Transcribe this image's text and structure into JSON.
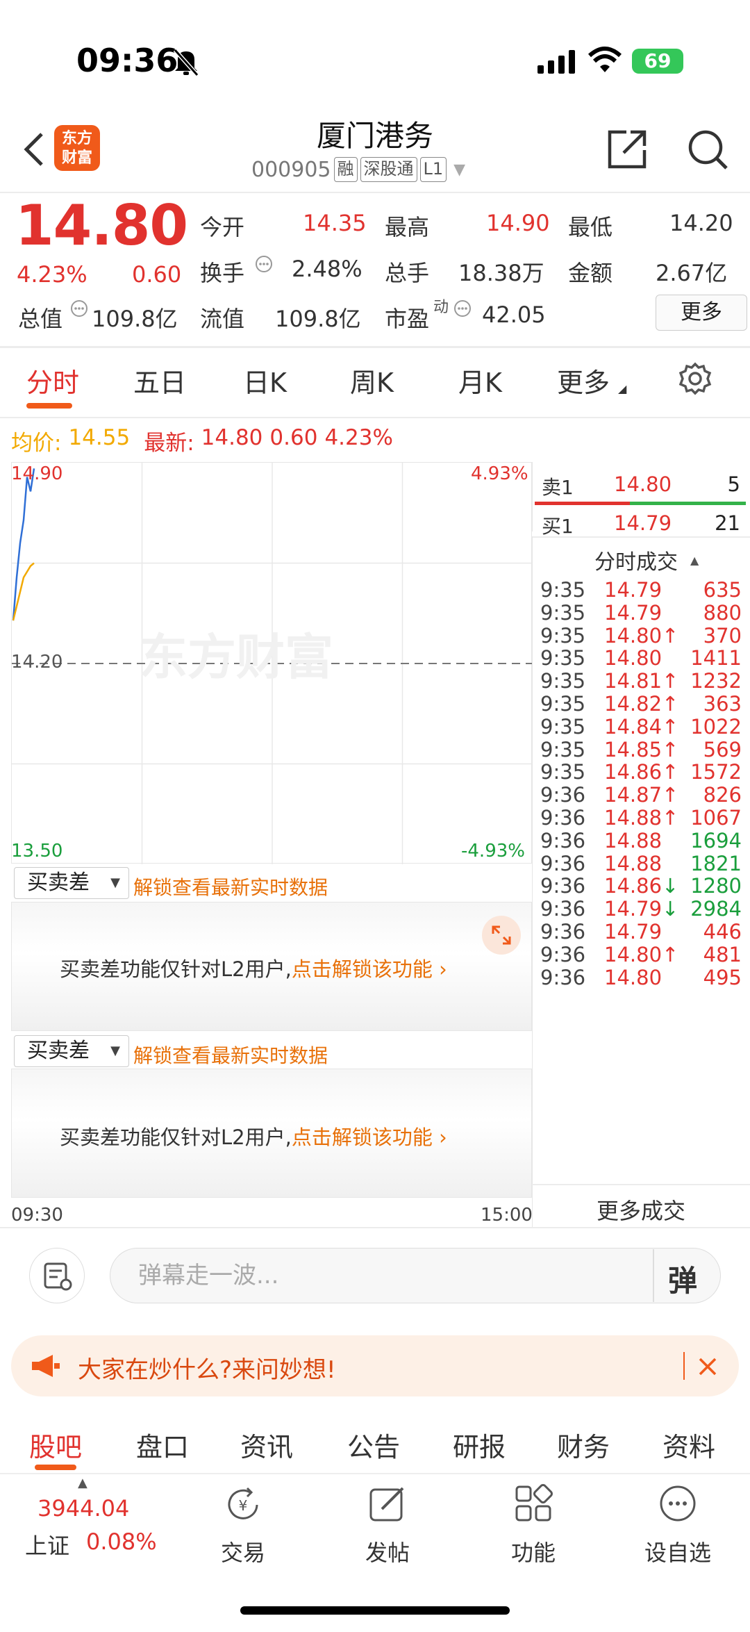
{
  "status_bar": {
    "time": "09:36",
    "battery": "69"
  },
  "header": {
    "logo_text": "东方财富",
    "stock_name": "厦门港务",
    "stock_code": "000905",
    "tags": [
      "融",
      "深股通",
      "L1"
    ]
  },
  "quote": {
    "price": "14.80",
    "change_pct": "4.23%",
    "change": "0.60",
    "labels": {
      "open": "今开",
      "high": "最高",
      "low": "最低",
      "turnover_rate": "换手",
      "volume": "总手",
      "amount": "金额",
      "total_mv": "总值",
      "float_mv": "流值",
      "pe": "市盈"
    },
    "open": "14.35",
    "high": "14.90",
    "low": "14.20",
    "turnover_rate": "2.48%",
    "volume": "18.38万",
    "amount": "2.67亿",
    "total_mv": "109.8亿",
    "float_mv": "109.8亿",
    "pe_sup": "动",
    "pe": "42.05",
    "more_label": "更多"
  },
  "chart_tabs": [
    "分时",
    "五日",
    "日K",
    "周K",
    "月K",
    "更多"
  ],
  "summary_line": {
    "avg_label": "均价:",
    "avg": "14.55",
    "latest_label": "最新:",
    "latest": "14.80",
    "change": "0.60",
    "pct": "4.23%"
  },
  "chart_data": {
    "type": "line",
    "title": "",
    "x_labels": [
      "09:30",
      "15:00"
    ],
    "ylim": [
      13.5,
      14.9
    ],
    "y_tick_labels": [
      "14.90",
      "14.20",
      "13.50"
    ],
    "right_tick_labels": [
      "4.93%",
      "-4.93%"
    ],
    "watermark": "东方财富",
    "series": [
      {
        "name": "",
        "color": "#2f6fd6",
        "x": [
          "09:30",
          "09:31",
          "09:32",
          "09:33",
          "09:34",
          "09:35",
          "09:36"
        ],
        "values": [
          14.35,
          14.5,
          14.62,
          14.7,
          14.85,
          14.8,
          14.88
        ]
      },
      {
        "name": "",
        "color": "#f2a900",
        "x": [
          "09:30",
          "09:31",
          "09:32",
          "09:33",
          "09:34",
          "09:35",
          "09:36"
        ],
        "values": [
          14.35,
          14.4,
          14.45,
          14.5,
          14.52,
          14.54,
          14.55
        ]
      }
    ]
  },
  "order_book": {
    "sell1": {
      "label": "卖1",
      "price": "14.80",
      "vol": "5"
    },
    "buy1": {
      "label": "买1",
      "price": "14.79",
      "vol": "21"
    }
  },
  "trades_title": "分时成交",
  "trades": [
    {
      "time": "9:35",
      "price": "14.79",
      "arrow": "",
      "vol": "635",
      "color": "red"
    },
    {
      "time": "9:35",
      "price": "14.79",
      "arrow": "",
      "vol": "880",
      "color": "red"
    },
    {
      "time": "9:35",
      "price": "14.80",
      "arrow": "↑",
      "vol": "370",
      "color": "red"
    },
    {
      "time": "9:35",
      "price": "14.80",
      "arrow": "",
      "vol": "1411",
      "color": "red"
    },
    {
      "time": "9:35",
      "price": "14.81",
      "arrow": "↑",
      "vol": "1232",
      "color": "red"
    },
    {
      "time": "9:35",
      "price": "14.82",
      "arrow": "↑",
      "vol": "363",
      "color": "red"
    },
    {
      "time": "9:35",
      "price": "14.84",
      "arrow": "↑",
      "vol": "1022",
      "color": "red"
    },
    {
      "time": "9:35",
      "price": "14.85",
      "arrow": "↑",
      "vol": "569",
      "color": "red"
    },
    {
      "time": "9:35",
      "price": "14.86",
      "arrow": "↑",
      "vol": "1572",
      "color": "red"
    },
    {
      "time": "9:36",
      "price": "14.87",
      "arrow": "↑",
      "vol": "826",
      "color": "red"
    },
    {
      "time": "9:36",
      "price": "14.88",
      "arrow": "↑",
      "vol": "1067",
      "color": "red"
    },
    {
      "time": "9:36",
      "price": "14.88",
      "arrow": "",
      "vol": "1694",
      "color": "green"
    },
    {
      "time": "9:36",
      "price": "14.88",
      "arrow": "",
      "vol": "1821",
      "color": "green"
    },
    {
      "time": "9:36",
      "price": "14.86",
      "arrow": "↓",
      "vol": "1280",
      "color": "green"
    },
    {
      "time": "9:36",
      "price": "14.79",
      "arrow": "↓",
      "vol": "2984",
      "color": "green"
    },
    {
      "time": "9:36",
      "price": "14.79",
      "arrow": "",
      "vol": "446",
      "color": "red"
    },
    {
      "time": "9:36",
      "price": "14.80",
      "arrow": "↑",
      "vol": "481",
      "color": "red"
    },
    {
      "time": "9:36",
      "price": "14.80",
      "arrow": "",
      "vol": "495",
      "color": "red"
    }
  ],
  "more_trades": "更多成交",
  "l2_blocks": [
    {
      "select": "买卖差",
      "unlock_tip": "解锁查看最新实时数据",
      "msg": "买卖差功能仅针对L2用户,",
      "cta": "点击解锁该功能"
    },
    {
      "select": "买卖差",
      "unlock_tip": "解锁查看最新实时数据",
      "msg": "买卖差功能仅针对L2用户,",
      "cta": "点击解锁该功能"
    }
  ],
  "danmu_placeholder": "弹幕走一波...",
  "danmu_btn": "弹",
  "ask_banner": "大家在炒什么?来问妙想!",
  "bottom_tabs": [
    "股吧",
    "盘口",
    "资讯",
    "公告",
    "研报",
    "财务",
    "资料"
  ],
  "index": {
    "value": "3944.04",
    "name": "上证",
    "pct": "0.08%"
  },
  "nav": [
    "交易",
    "发帖",
    "功能",
    "设自选"
  ]
}
